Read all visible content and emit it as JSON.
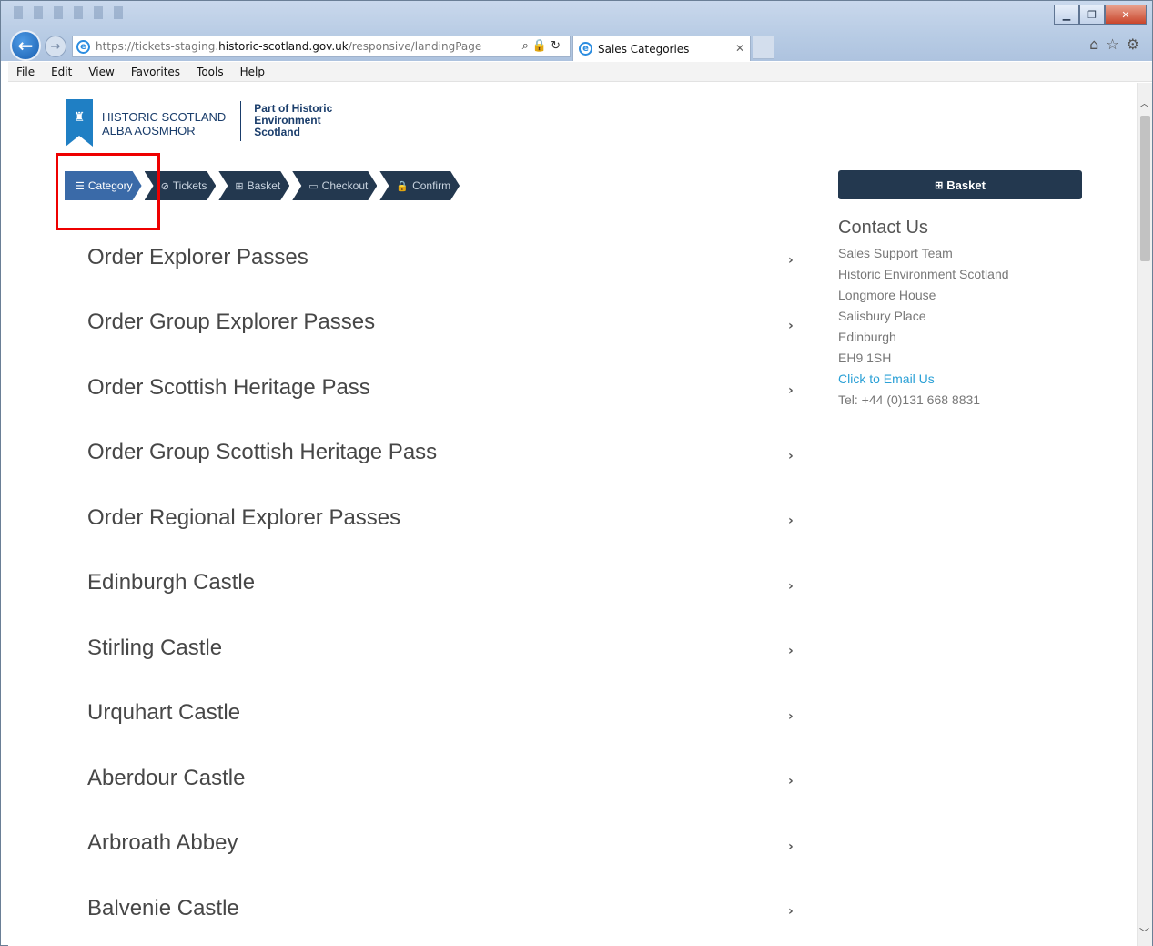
{
  "browser": {
    "url_prefix": "https://tickets-staging.",
    "url_domain": "historic-scotland.gov.uk",
    "url_path": "/responsive/landingPage",
    "tab_title": "Sales Categories",
    "menu": [
      "File",
      "Edit",
      "View",
      "Favorites",
      "Tools",
      "Help"
    ]
  },
  "logo": {
    "line1": "HISTORIC SCOTLAND",
    "line2": "ALBA AOSMHOR",
    "sub1": "Part of Historic",
    "sub2": "Environment",
    "sub3": "Scotland"
  },
  "steps": [
    {
      "label": "Category",
      "icon": "menu-icon"
    },
    {
      "label": "Tickets",
      "icon": "ticket-icon"
    },
    {
      "label": "Basket",
      "icon": "cart-icon"
    },
    {
      "label": "Checkout",
      "icon": "card-icon"
    },
    {
      "label": "Confirm",
      "icon": "lock-icon"
    }
  ],
  "categories": [
    "Order Explorer Passes",
    "Order Group Explorer Passes",
    "Order Scottish Heritage Pass",
    "Order Group Scottish Heritage Pass",
    "Order Regional Explorer Passes",
    "Edinburgh Castle",
    "Stirling Castle",
    "Urquhart Castle",
    "Aberdour Castle",
    "Arbroath Abbey",
    "Balvenie Castle"
  ],
  "sidebar": {
    "basket_label": "Basket",
    "contact_title": "Contact Us",
    "contact_lines": [
      "Sales Support Team",
      "Historic Environment Scotland",
      "Longmore House",
      "Salisbury Place",
      "Edinburgh",
      "EH9 1SH"
    ],
    "email_link": "Click to Email Us",
    "phone": "Tel: +44 (0)131 668 8831"
  },
  "colors": {
    "nav_dark": "#23384f",
    "nav_active": "#3a6aa8",
    "highlight": "#ee0000",
    "link": "#2aa0d6"
  }
}
